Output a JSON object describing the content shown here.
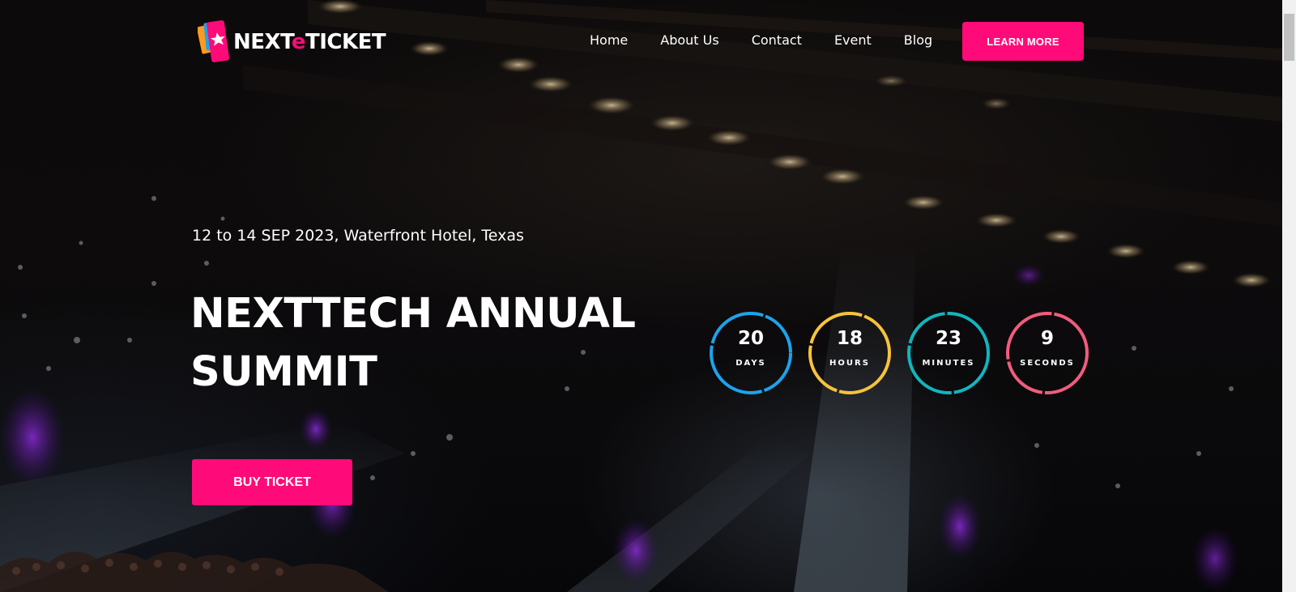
{
  "brand": {
    "name_part1": "NEXT",
    "name_accent": "e",
    "name_part2": "TICKET",
    "accent_color": "#ff0a78"
  },
  "nav": {
    "items": [
      {
        "label": "Home"
      },
      {
        "label": "About Us"
      },
      {
        "label": "Contact"
      },
      {
        "label": "Event"
      },
      {
        "label": "Blog"
      }
    ],
    "cta_label": "LEARN MORE"
  },
  "hero": {
    "event_info": "12 to 14 SEP 2023, Waterfront Hotel, Texas",
    "title_line1": "NEXTTECH ANNUAL",
    "title_line2": "SUMMIT",
    "buy_label": "BUY TICKET"
  },
  "countdown": [
    {
      "value": "20",
      "label": "DAYS",
      "color": "#1ca3ec"
    },
    {
      "value": "18",
      "label": "HOURS",
      "color": "#f8c33a"
    },
    {
      "value": "23",
      "label": "MINUTES",
      "color": "#12b5bd"
    },
    {
      "value": "9",
      "label": "SECONDS",
      "color": "#f05c7e"
    }
  ],
  "icons": {
    "logo": "ticket-logo-icon"
  }
}
